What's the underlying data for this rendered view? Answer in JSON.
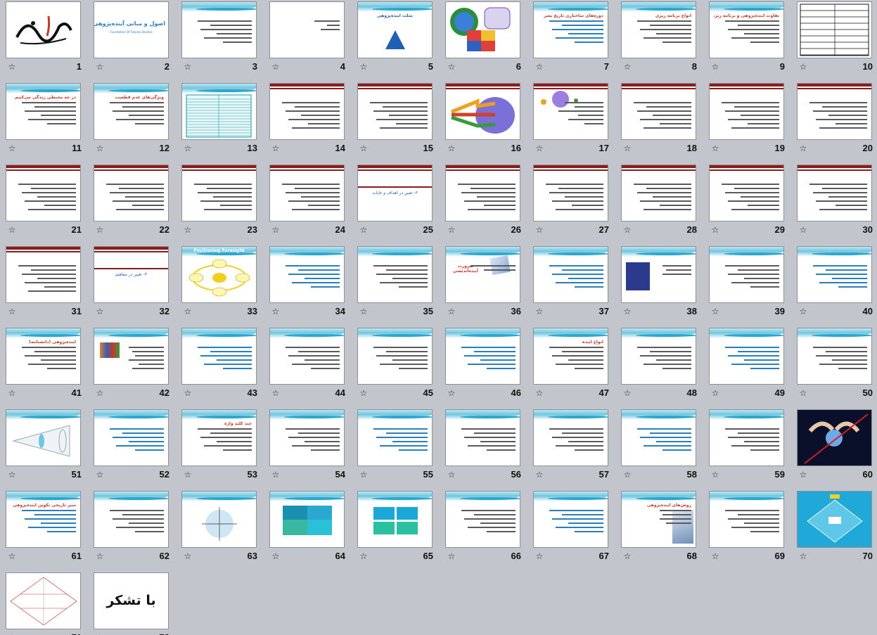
{
  "sorter": {
    "slides": [
      {
        "n": "1",
        "kind": "calligraphy"
      },
      {
        "n": "2",
        "kind": "cover",
        "title": "اصول و مبانی آینده‌پژوهی",
        "subtitle": "Foundation Of Futures Studies"
      },
      {
        "n": "3",
        "kind": "text"
      },
      {
        "n": "4",
        "kind": "sparse"
      },
      {
        "n": "5",
        "kind": "triangle",
        "title": "مثلث آینده‌پژوهی"
      },
      {
        "n": "6",
        "kind": "puzzle"
      },
      {
        "n": "7",
        "kind": "text",
        "title": "دوره‌های ساختاری تاریخ بشر"
      },
      {
        "n": "8",
        "kind": "text",
        "title": "انواع برنامه ریزی"
      },
      {
        "n": "9",
        "kind": "text",
        "title": "تفاوت آینده‌پژوهی و برنامه ریزی"
      },
      {
        "n": "10",
        "kind": "table"
      },
      {
        "n": "11",
        "kind": "text",
        "title": "در چه محیطی زندگی می‌کنیم"
      },
      {
        "n": "12",
        "kind": "text",
        "title": "ویژگی‌های عدم قطعیت"
      },
      {
        "n": "13",
        "kind": "tealtable"
      },
      {
        "n": "14",
        "kind": "redtext"
      },
      {
        "n": "15",
        "kind": "redtext"
      },
      {
        "n": "16",
        "kind": "arrows"
      },
      {
        "n": "17",
        "kind": "bubble"
      },
      {
        "n": "18",
        "kind": "redtext"
      },
      {
        "n": "19",
        "kind": "redtext"
      },
      {
        "n": "20",
        "kind": "redtext"
      },
      {
        "n": "21",
        "kind": "redtext"
      },
      {
        "n": "22",
        "kind": "redtext"
      },
      {
        "n": "23",
        "kind": "redtext"
      },
      {
        "n": "24",
        "kind": "redtext"
      },
      {
        "n": "25",
        "kind": "section",
        "title": "۳- تغییر در اهداف و غایات"
      },
      {
        "n": "26",
        "kind": "redtext"
      },
      {
        "n": "27",
        "kind": "redtext"
      },
      {
        "n": "28",
        "kind": "redtext"
      },
      {
        "n": "29",
        "kind": "redtext"
      },
      {
        "n": "30",
        "kind": "redtext"
      },
      {
        "n": "31",
        "kind": "redtext"
      },
      {
        "n": "32",
        "kind": "section",
        "title": "۴- تغییر در مفاهیم"
      },
      {
        "n": "33",
        "kind": "ellipse",
        "title": "Positioning Foresight"
      },
      {
        "n": "34",
        "kind": "text"
      },
      {
        "n": "35",
        "kind": "text"
      },
      {
        "n": "36",
        "kind": "image",
        "title": "ضرورت آینده‌اندیشی"
      },
      {
        "n": "37",
        "kind": "text"
      },
      {
        "n": "38",
        "kind": "figure"
      },
      {
        "n": "39",
        "kind": "text"
      },
      {
        "n": "40",
        "kind": "text"
      },
      {
        "n": "41",
        "kind": "text",
        "title": "آینده‌پژوهی (دانشنامه)"
      },
      {
        "n": "42",
        "kind": "books"
      },
      {
        "n": "43",
        "kind": "text"
      },
      {
        "n": "44",
        "kind": "text"
      },
      {
        "n": "45",
        "kind": "text"
      },
      {
        "n": "46",
        "kind": "text"
      },
      {
        "n": "47",
        "kind": "text",
        "title": "انواع آینده"
      },
      {
        "n": "48",
        "kind": "text"
      },
      {
        "n": "49",
        "kind": "text"
      },
      {
        "n": "50",
        "kind": "text"
      },
      {
        "n": "51",
        "kind": "cone"
      },
      {
        "n": "52",
        "kind": "text"
      },
      {
        "n": "53",
        "kind": "text",
        "title": "چند کلید واژه"
      },
      {
        "n": "54",
        "kind": "text"
      },
      {
        "n": "55",
        "kind": "text"
      },
      {
        "n": "56",
        "kind": "text"
      },
      {
        "n": "57",
        "kind": "text"
      },
      {
        "n": "58",
        "kind": "text"
      },
      {
        "n": "59",
        "kind": "text"
      },
      {
        "n": "60",
        "kind": "globe"
      },
      {
        "n": "61",
        "kind": "text",
        "title": "سیر تاریخی تکوین آینده‌پژوهی"
      },
      {
        "n": "62",
        "kind": "text"
      },
      {
        "n": "63",
        "kind": "circle"
      },
      {
        "n": "64",
        "kind": "quad"
      },
      {
        "n": "65",
        "kind": "quad2"
      },
      {
        "n": "66",
        "kind": "text"
      },
      {
        "n": "67",
        "kind": "text"
      },
      {
        "n": "68",
        "kind": "photo",
        "title": "روش‌های آینده‌پژوهی"
      },
      {
        "n": "69",
        "kind": "text"
      },
      {
        "n": "70",
        "kind": "bluediagram"
      },
      {
        "n": "71",
        "kind": "diamond"
      },
      {
        "n": "72",
        "kind": "thanks",
        "title": "با تشکر"
      }
    ]
  },
  "ui": {
    "star_icon": "☆",
    "colors": {
      "background": "#c3c5cc",
      "accent_red": "#c0392b",
      "accent_blue": "#2a7fc0",
      "wave": "#6fc6df"
    }
  }
}
